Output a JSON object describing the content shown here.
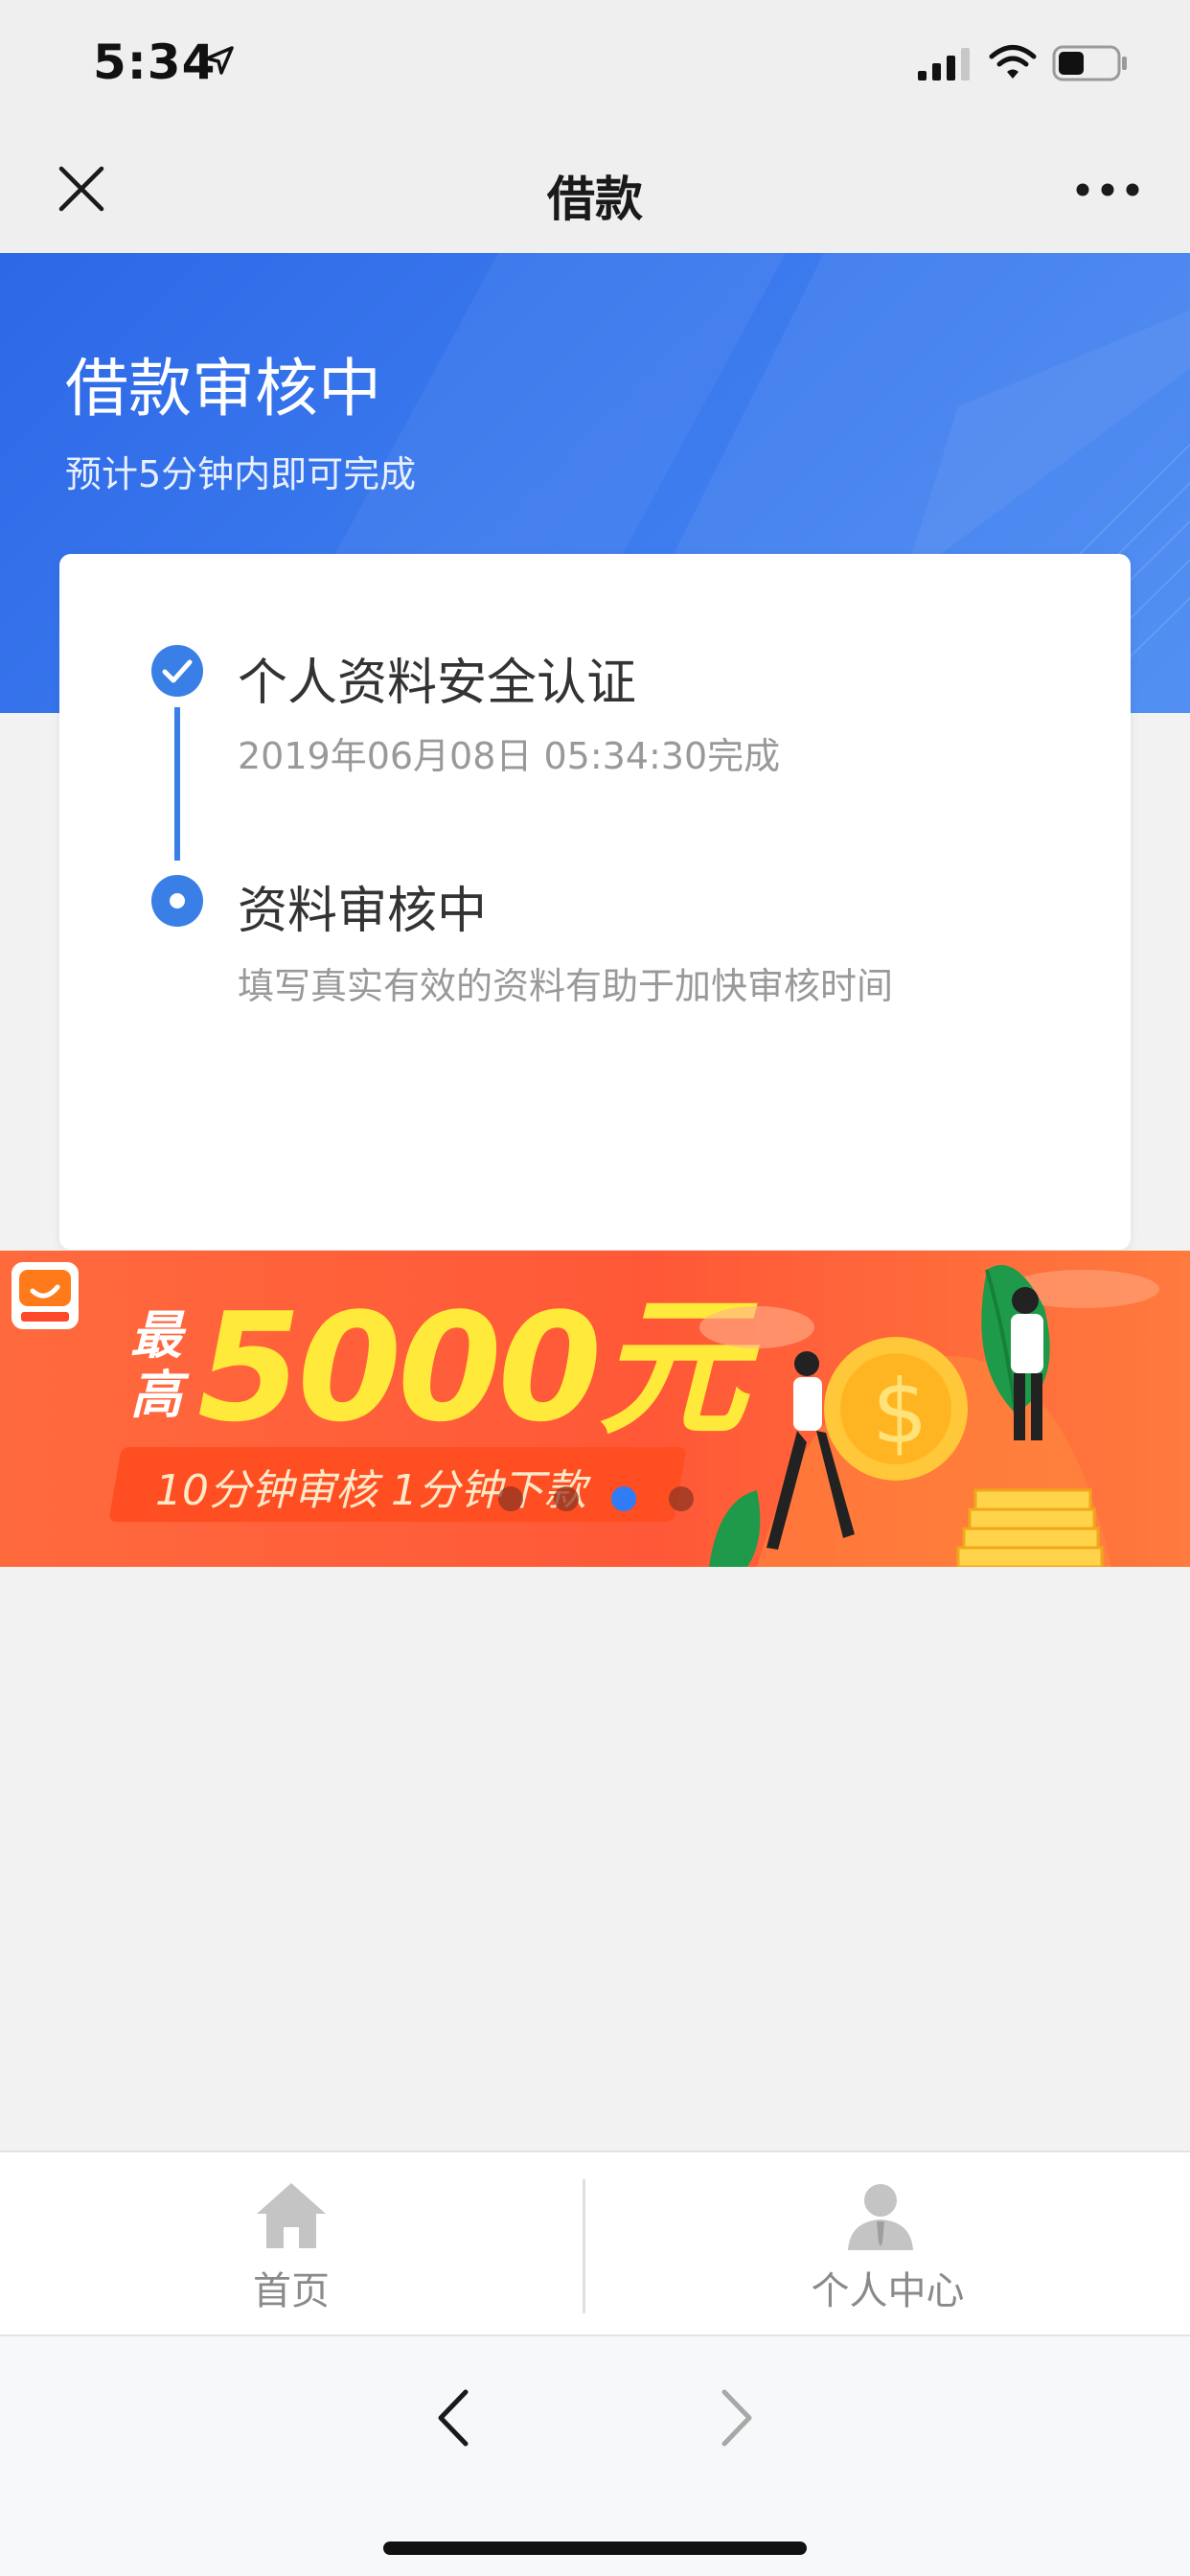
{
  "status_bar": {
    "time": "5:34",
    "icons": [
      "location-arrow-icon",
      "signal-icon",
      "wifi-icon",
      "battery-icon"
    ]
  },
  "nav": {
    "title": "借款",
    "left_icon": "close-icon",
    "right_icon": "more-icon"
  },
  "hero": {
    "title": "借款审核中",
    "subtitle": "预计5分钟内即可完成"
  },
  "steps": [
    {
      "title": "个人资料安全认证",
      "detail": "2019年06月08日 05:34:30完成",
      "state": "done"
    },
    {
      "title": "资料审核中",
      "detail": "填写真实有效的资料有助于加快审核时间",
      "state": "current"
    }
  ],
  "banner": {
    "prefix": "最高",
    "amount": "5000元",
    "slogan": "10分钟审核  1分钟下款",
    "carousel": {
      "count": 4,
      "active_index": 2
    }
  },
  "tabs": [
    {
      "label": "首页",
      "icon": "home-icon"
    },
    {
      "label": "个人中心",
      "icon": "user-icon"
    }
  ],
  "browser": {
    "icons": [
      "back-icon",
      "forward-icon"
    ]
  },
  "colors": {
    "accent": "#3a7fe6",
    "hero": "#3574ec",
    "banner": "#ff5a3a",
    "amount": "#ffea3b"
  }
}
